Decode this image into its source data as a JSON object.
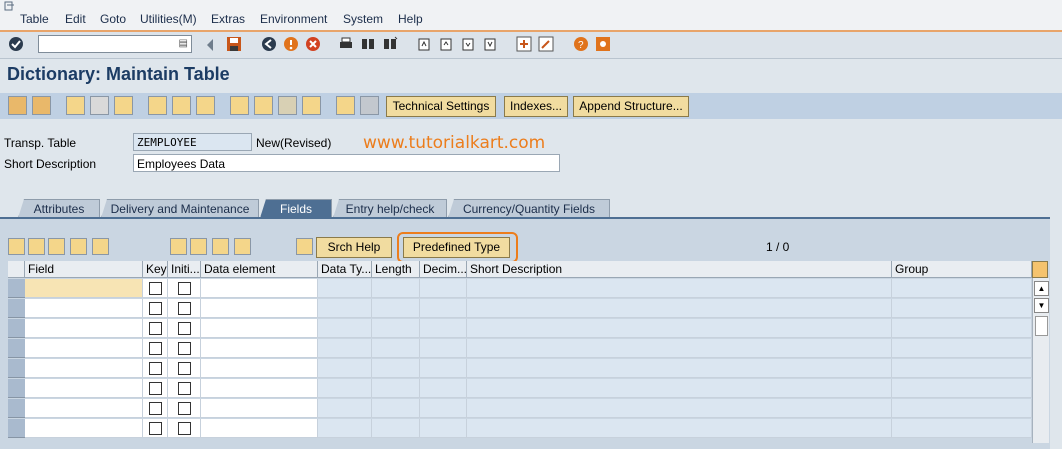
{
  "menu": {
    "items": [
      "Table",
      "Edit",
      "Goto",
      "Utilities(M)",
      "Extras",
      "Environment",
      "System",
      "Help"
    ]
  },
  "system_toolbar": {
    "command_value": ""
  },
  "screen": {
    "title": "Dictionary: Maintain Table"
  },
  "app_toolbar": {
    "technical_settings": "Technical Settings",
    "indexes": "Indexes...",
    "append_structure": "Append Structure..."
  },
  "header": {
    "transp_table_label": "Transp. Table",
    "transp_table_value": "ZEMPLOYEE",
    "status": "New(Revised)",
    "short_desc_label": "Short Description",
    "short_desc_value": "Employees Data"
  },
  "watermark": "www.tutorialkart.com",
  "tabs": [
    "Attributes",
    "Delivery and Maintenance",
    "Fields",
    "Entry help/check",
    "Currency/Quantity Fields"
  ],
  "active_tab": "Fields",
  "fields_toolbar": {
    "srch_help": "Srch Help",
    "predefined_type": "Predefined Type",
    "counter": "1  /  0"
  },
  "table": {
    "columns": [
      "Field",
      "Key",
      "Initi...",
      "Data element",
      "Data Ty...",
      "Length",
      "Decim...",
      "Short Description",
      "Group"
    ],
    "rows": [
      {
        "field": "",
        "key": false,
        "initial": false,
        "data_element": "",
        "data_type": "",
        "length": "",
        "decimals": "",
        "short_description": "",
        "group": ""
      },
      {
        "field": "",
        "key": false,
        "initial": false,
        "data_element": "",
        "data_type": "",
        "length": "",
        "decimals": "",
        "short_description": "",
        "group": ""
      },
      {
        "field": "",
        "key": false,
        "initial": false,
        "data_element": "",
        "data_type": "",
        "length": "",
        "decimals": "",
        "short_description": "",
        "group": ""
      },
      {
        "field": "",
        "key": false,
        "initial": false,
        "data_element": "",
        "data_type": "",
        "length": "",
        "decimals": "",
        "short_description": "",
        "group": ""
      },
      {
        "field": "",
        "key": false,
        "initial": false,
        "data_element": "",
        "data_type": "",
        "length": "",
        "decimals": "",
        "short_description": "",
        "group": ""
      },
      {
        "field": "",
        "key": false,
        "initial": false,
        "data_element": "",
        "data_type": "",
        "length": "",
        "decimals": "",
        "short_description": "",
        "group": ""
      },
      {
        "field": "",
        "key": false,
        "initial": false,
        "data_element": "",
        "data_type": "",
        "length": "",
        "decimals": "",
        "short_description": "",
        "group": ""
      },
      {
        "field": "",
        "key": false,
        "initial": false,
        "data_element": "",
        "data_type": "",
        "length": "",
        "decimals": "",
        "short_description": "",
        "group": ""
      }
    ]
  },
  "colors": {
    "accent_orange": "#ec7d1c",
    "title_blue": "#1c3c64",
    "tab_active": "#4e6f93",
    "button_fill": "#f1dca0"
  }
}
